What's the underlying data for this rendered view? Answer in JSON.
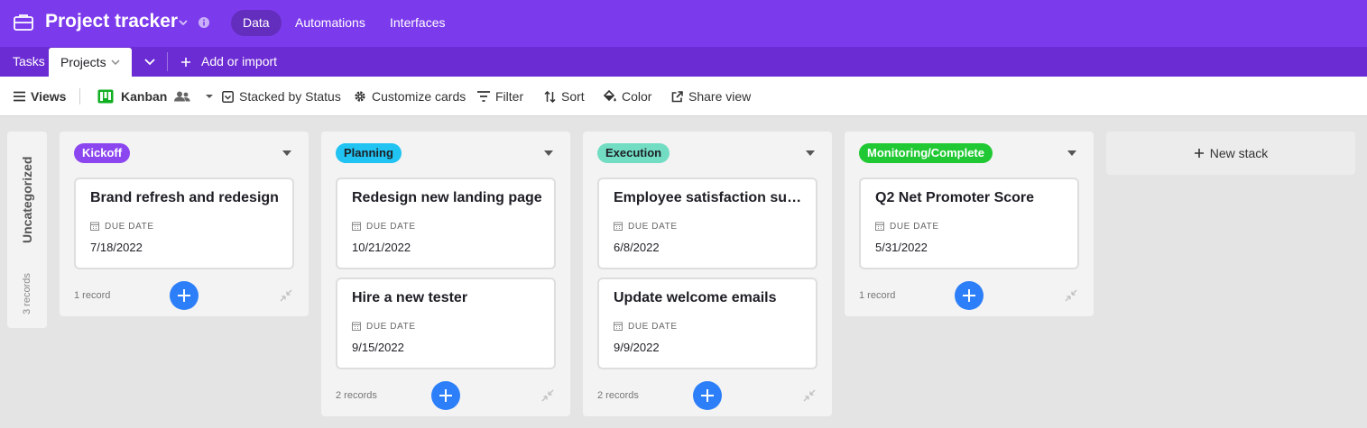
{
  "app": {
    "base_name": "Project tracker",
    "nav": [
      "Data",
      "Automations",
      "Interfaces"
    ],
    "active_nav": "Data"
  },
  "tables": {
    "tabs": [
      "Tasks",
      "Projects"
    ],
    "active": "Projects",
    "add_label": "Add or import"
  },
  "view": {
    "views_label": "Views",
    "view_name": "Kanban",
    "stacked_by": "Stacked by Status",
    "customize": "Customize cards",
    "filter": "Filter",
    "sort": "Sort",
    "color": "Color",
    "share": "Share view"
  },
  "board": {
    "uncategorized": {
      "label": "Uncategorized",
      "count": "3 records"
    },
    "field_label": "DUE DATE",
    "stacks": [
      {
        "status": "Kickoff",
        "color": "#8b46f0",
        "text_color": "#ffffff",
        "count": "1 record",
        "cards": [
          {
            "title": "Brand refresh and redesign",
            "due": "7/18/2022"
          }
        ]
      },
      {
        "status": "Planning",
        "color": "#20c3f1",
        "text_color": "#1d1f25",
        "count": "2 records",
        "cards": [
          {
            "title": "Redesign new landing page",
            "due": "10/21/2022"
          },
          {
            "title": "Hire a new tester",
            "due": "9/15/2022"
          }
        ]
      },
      {
        "status": "Execution",
        "color": "#72ddc3",
        "text_color": "#1d1f25",
        "count": "2 records",
        "cards": [
          {
            "title": "Employee satisfaction surv...",
            "due": "6/8/2022"
          },
          {
            "title": "Update welcome emails",
            "due": "9/9/2022"
          }
        ]
      },
      {
        "status": "Monitoring/Complete",
        "color": "#20c933",
        "text_color": "#ffffff",
        "count": "1 record",
        "cards": [
          {
            "title": "Q2 Net Promoter Score",
            "due": "5/31/2022"
          }
        ]
      }
    ],
    "new_stack": "New stack"
  },
  "colors": {
    "header": "#7c3aed",
    "tabbar": "#6c2cd3",
    "accent_blue": "#2d7ff9"
  }
}
